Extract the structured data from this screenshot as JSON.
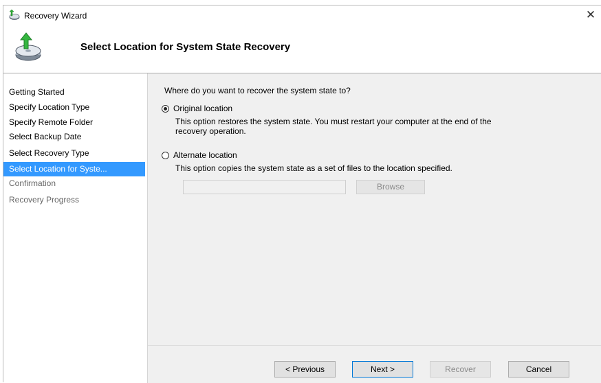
{
  "window": {
    "title": "Recovery Wizard",
    "close_glyph": "✕"
  },
  "header": {
    "title": "Select Location for System State Recovery",
    "icon": "recovery-disk-icon"
  },
  "sidebar": {
    "items": [
      {
        "label": "Getting Started",
        "state": "done"
      },
      {
        "label": "Specify Location Type",
        "state": "done"
      },
      {
        "label": "Specify Remote Folder",
        "state": "done"
      },
      {
        "label": "Select Backup Date",
        "state": "done"
      },
      {
        "label": "Select Recovery Type",
        "state": "done"
      },
      {
        "label": "Select Location for Syste...",
        "state": "active"
      },
      {
        "label": "Confirmation",
        "state": "pending"
      },
      {
        "label": "Recovery Progress",
        "state": "pending"
      }
    ]
  },
  "main": {
    "question": "Where do you want to recover the system state to?",
    "options": [
      {
        "label": "Original location",
        "checked": true,
        "desc_line1": "This option restores the system state. You must restart your computer at the end of the",
        "desc_line2": "recovery operation."
      },
      {
        "label": "Alternate location",
        "checked": false,
        "desc_line1": "This option copies the system state as a set of files to the location specified."
      }
    ],
    "path_value": "",
    "browse_label": "Browse"
  },
  "footer": {
    "previous_label": "< Previous",
    "next_label": "Next >",
    "recover_label": "Recover",
    "cancel_label": "Cancel"
  },
  "colors": {
    "active_nav": "#3399ff",
    "content_bg": "#f0f0f0",
    "default_button_border": "#0078d7"
  }
}
